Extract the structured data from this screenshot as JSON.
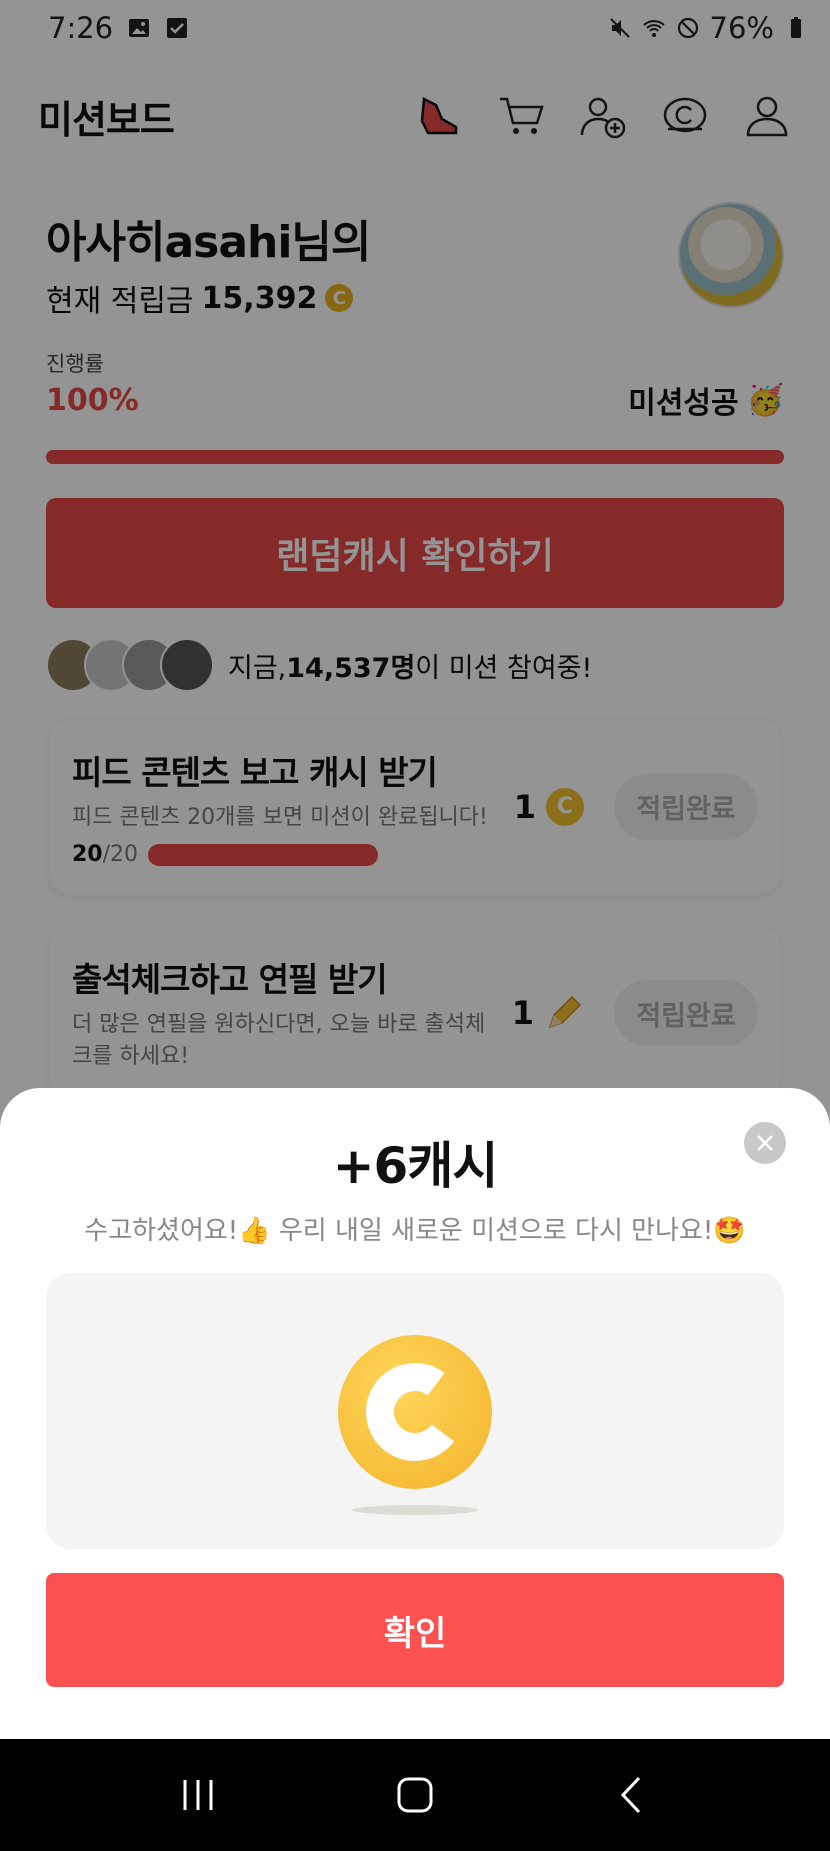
{
  "status_bar": {
    "time": "7:26",
    "battery": "76%"
  },
  "header": {
    "title": "미션보드"
  },
  "profile": {
    "greeting": "아사히asahi님의",
    "balance_label": "현재 적립금",
    "balance_value": "15,392",
    "coin_symbol": "C"
  },
  "progress": {
    "label": "진행률",
    "percent": "100%",
    "value": 1.0,
    "success_text": "미션성공"
  },
  "random_cash_button": "랜덤캐시 확인하기",
  "participants": {
    "prefix": "지금, ",
    "count": "14,537명",
    "suffix": "이 미션 참여중!"
  },
  "missions": [
    {
      "title": "피드 콘텐츠 보고 캐시 받기",
      "desc": "피드 콘텐츠 20개를 보면 미션이 완료됩니다!",
      "progress_current": "20",
      "progress_total": "/20",
      "reward": "1",
      "status": "적립완료"
    },
    {
      "title": "출석체크하고 연필 받기",
      "desc": "더 많은 연필을 원하신다면, 오늘 바로 출석체크를 하세요!",
      "reward": "1",
      "status": "적립완료"
    }
  ],
  "modal": {
    "title": "+6캐시",
    "subtitle": "수고하셨어요!👍 우리 내일 새로운 미션으로 다시 만나요!🤩",
    "confirm_label": "확인"
  },
  "colors": {
    "accent": "#e54848",
    "confirm": "#fb5151",
    "coin": "#f2bf2f"
  }
}
